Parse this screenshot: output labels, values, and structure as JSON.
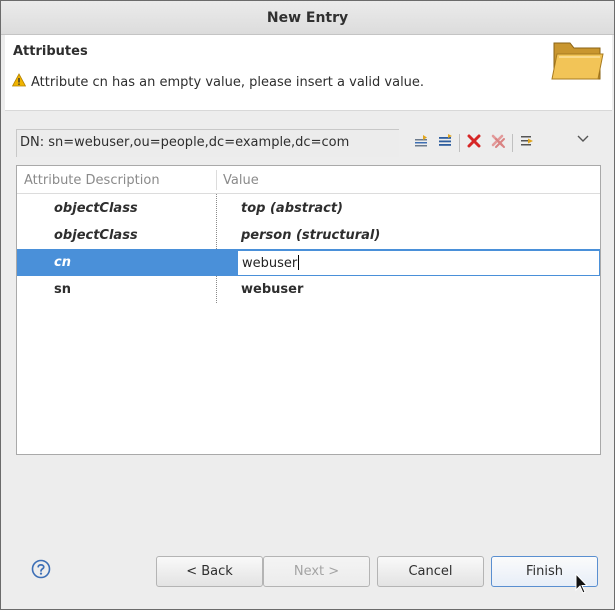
{
  "window": {
    "title": "New Entry"
  },
  "banner": {
    "title": "Attributes",
    "message": "Attribute cn has an empty value, please insert a valid value.",
    "icon": "folder-icon",
    "message_icon": "warning-icon"
  },
  "dn": {
    "text": "DN: sn=webuser,ou=people,dc=example,dc=com"
  },
  "toolbar": {
    "buttons": [
      "new-attribute-icon",
      "new-value-icon",
      "delete-icon",
      "delete-all-icon",
      "toggle-editor-icon"
    ]
  },
  "table": {
    "columns": [
      "Attribute Description",
      "Value"
    ],
    "rows": [
      {
        "description": "objectClass",
        "value": "top (abstract)"
      },
      {
        "description": "objectClass",
        "value": "person (structural)"
      },
      {
        "description": "cn",
        "value": "webuser",
        "selected": true,
        "editing": true
      },
      {
        "description": "sn",
        "value": "webuser"
      }
    ]
  },
  "buttons": {
    "back": "< Back",
    "next": "Next >",
    "cancel": "Cancel",
    "finish": "Finish"
  },
  "colors": {
    "selection": "#4a90d9",
    "warning": "#f0b400",
    "delete": "#d62626",
    "help": "#3d6fb6"
  }
}
